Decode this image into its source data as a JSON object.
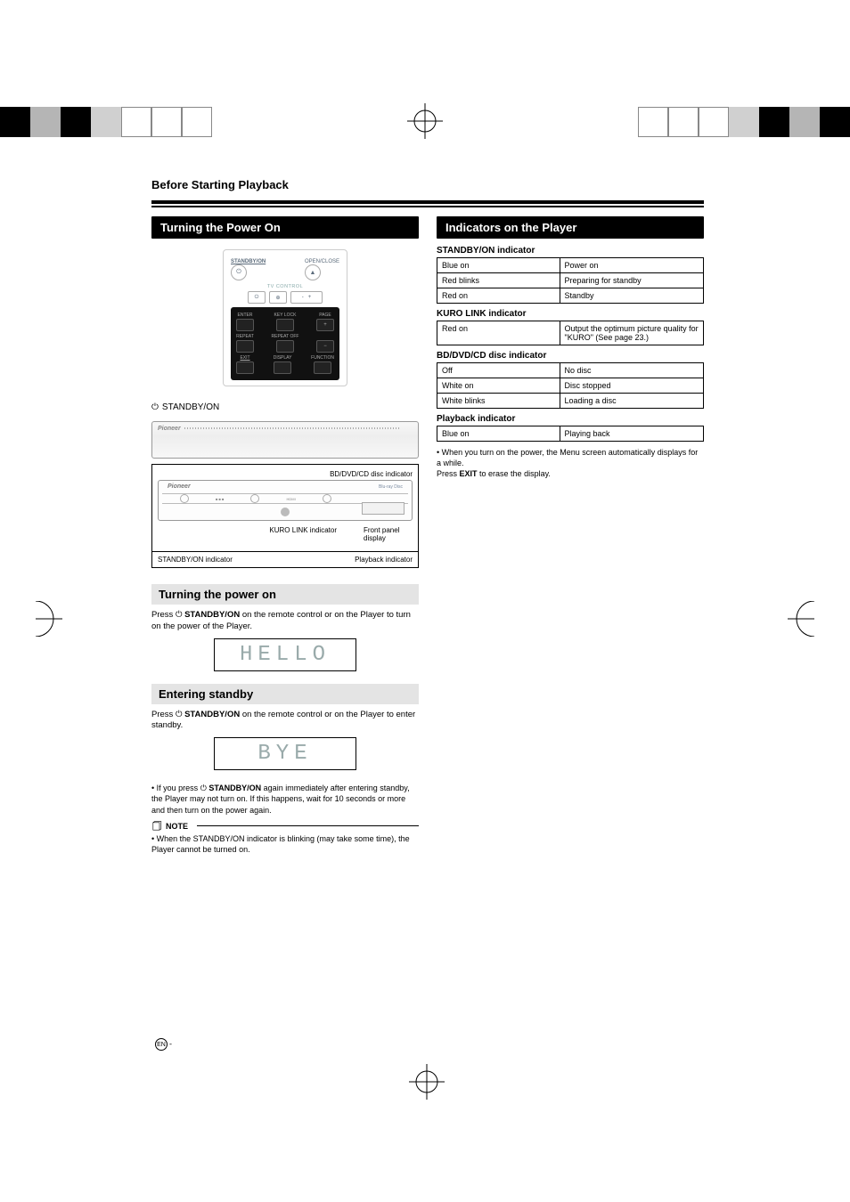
{
  "page_section_title": "Before Starting Playback",
  "left": {
    "heading": "Turning the Power On",
    "remote": {
      "standby_label": "STANDBY/ON",
      "open_close_label": "OPEN/CLOSE",
      "tv_control_label": "TV CONTROL",
      "enter": "ENTER",
      "key_lock": "KEY LOCK",
      "page": "PAGE",
      "repeat": "REPEAT",
      "repeat_off": "REPEAT OFF",
      "exit": "EXIT",
      "display": "DISPLAY",
      "function": "FUNCTION",
      "plus": "+",
      "minus": "−"
    },
    "standby_line": "STANDBY/ON",
    "player": {
      "bdcd_label": "BD/DVD/CD disc indicator",
      "kuro_label": "KURO LINK indicator",
      "front_panel": "Front panel display",
      "standby_ind": "STANDBY/ON indicator",
      "playback_ind": "Playback indicator",
      "brand": "Pioneer",
      "bluray": "Blu-ray Disc"
    },
    "turning_on": {
      "bar": "Turning the power on",
      "text_pre": "Press ",
      "text_btn": "STANDBY/ON",
      "text_post": " on the remote control or on the Player to turn on the power of the Player.",
      "lcd": "HELLO"
    },
    "standby": {
      "bar": "Entering standby",
      "text_pre": "Press ",
      "text_btn": "STANDBY/ON",
      "text_post": " on the remote control or on the Player to enter standby.",
      "lcd": "BYE",
      "bullet_pre": "If you press ",
      "bullet_btn": "STANDBY/ON",
      "bullet_post": " again immediately after entering standby, the Player may not turn on. If this happens, wait for 10 seconds or more and then turn on the power again."
    },
    "note": {
      "label": "NOTE",
      "bullet": "When the STANDBY/ON indicator is blinking (may take some time), the Player cannot be turned on."
    }
  },
  "right": {
    "heading": "Indicators on the Player",
    "standby_h": "STANDBY/ON indicator",
    "standby_rows": [
      [
        "Blue on",
        "Power on"
      ],
      [
        "Red blinks",
        "Preparing for standby"
      ],
      [
        "Red on",
        "Standby"
      ]
    ],
    "kuro_h": "KURO LINK indicator",
    "kuro_rows": [
      [
        "Red on",
        "Output the optimum picture quality for \"KURO\" (See page 23.)"
      ]
    ],
    "disc_h": "BD/DVD/CD disc indicator",
    "disc_rows": [
      [
        "Off",
        "No disc"
      ],
      [
        "White on",
        "Disc stopped"
      ],
      [
        "White blinks",
        "Loading a disc"
      ]
    ],
    "play_h": "Playback indicator",
    "play_rows": [
      [
        "Blue on",
        "Playing back"
      ]
    ],
    "tail_bullet_a": "When you turn on the power, the Menu screen automatically displays for a while.",
    "tail_bullet_b": "Press ",
    "tail_bullet_btn": "EXIT",
    "tail_bullet_c": " to erase the display."
  },
  "footer": {
    "en": "EN",
    "dash": "-"
  }
}
